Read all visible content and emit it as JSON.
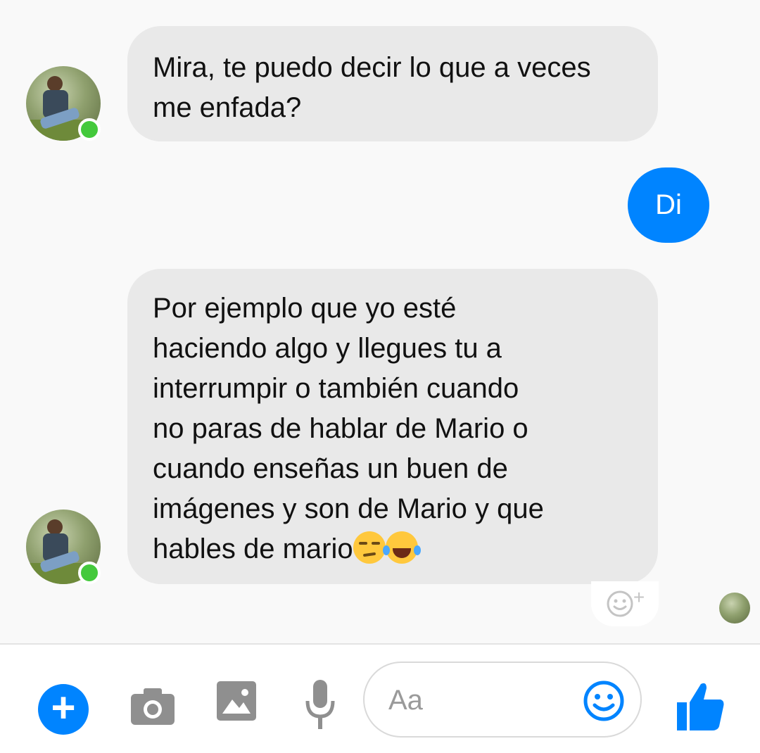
{
  "messages": {
    "msg1": "Mira, te puedo decir lo que a veces me enfada?",
    "msg2": "Di",
    "msg3_lines": [
      "Por ejemplo que yo esté",
      "haciendo algo y llegues tu a",
      "interrumpir o también cuando",
      "no paras de hablar de Mario o",
      "cuando enseñas un buen de",
      "imágenes y son de Mario y que"
    ],
    "msg3_last": "hables de mario"
  },
  "composer": {
    "placeholder": "Aa"
  },
  "colors": {
    "accent": "#0084ff",
    "incoming_bubble": "#e9e9e9",
    "online": "#44c93c"
  },
  "icons": [
    "plus-icon",
    "camera-icon",
    "image-icon",
    "microphone-icon",
    "emoji-icon",
    "thumbs-up-icon",
    "add-reaction-icon"
  ]
}
